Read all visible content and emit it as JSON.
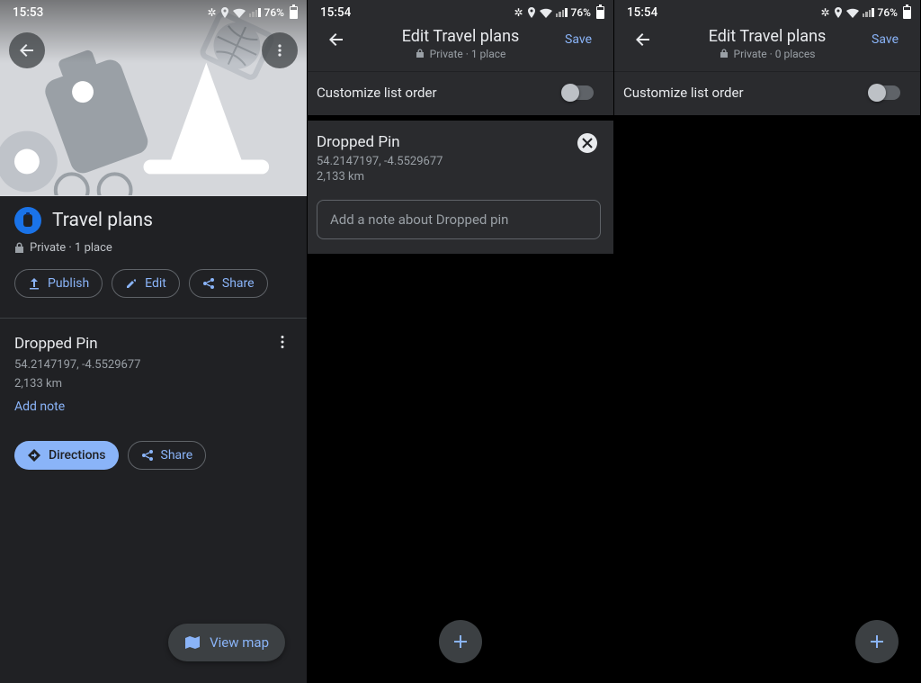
{
  "p1": {
    "status": {
      "time": "15:53",
      "battery": "76%"
    },
    "title": "Travel plans",
    "subtitle": "Private · 1 place",
    "actions": {
      "publish": "Publish",
      "edit": "Edit",
      "share": "Share"
    },
    "place": {
      "name": "Dropped Pin",
      "coords": "54.2147197, -4.5529677",
      "distance": "2,133 km",
      "add_note": "Add note",
      "directions": "Directions",
      "share": "Share"
    },
    "view_map": "View map"
  },
  "p2": {
    "status": {
      "time": "15:54",
      "battery": "76%"
    },
    "title": "Edit Travel plans",
    "subtitle": "Private · 1 place",
    "save": "Save",
    "customize": "Customize list order",
    "place": {
      "name": "Dropped Pin",
      "coords": "54.2147197, -4.5529677",
      "distance": "2,133 km",
      "note_placeholder": "Add a note about Dropped pin"
    }
  },
  "p3": {
    "status": {
      "time": "15:54",
      "battery": "76%"
    },
    "title": "Edit Travel plans",
    "subtitle": "Private · 0 places",
    "save": "Save",
    "customize": "Customize list order"
  }
}
